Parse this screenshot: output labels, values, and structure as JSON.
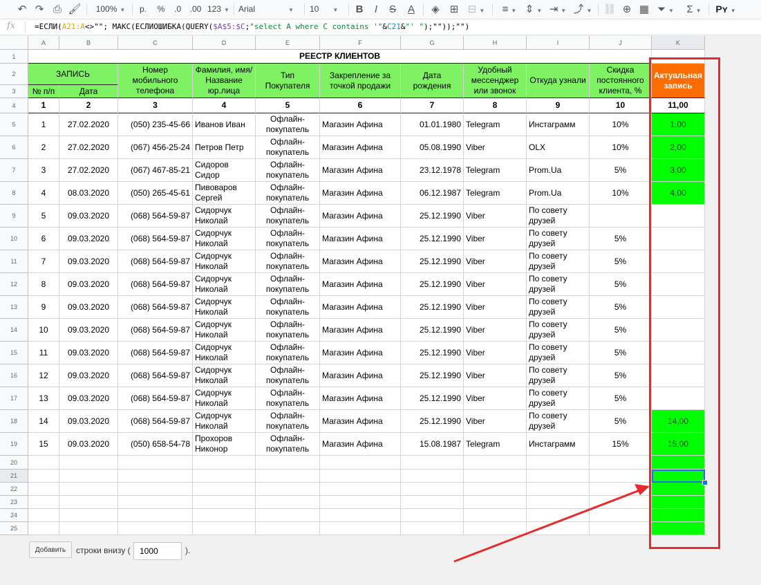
{
  "toolbar": {
    "zoom": "100%",
    "currency": "р.",
    "percent": "%",
    "dec_less": ".0",
    "dec_more": ".00",
    "num_format": "123",
    "font": "Arial",
    "size": "10",
    "sheet_script": "Pʏ",
    "icons": [
      "undo-icon",
      "redo-icon",
      "print-icon",
      "paint-format-icon",
      "bold-icon",
      "italic-icon",
      "strikethrough-icon",
      "text-color-icon",
      "fill-color-icon",
      "borders-icon",
      "merge-icon",
      "align-icon",
      "valign-icon",
      "wrap-icon",
      "rotate-icon",
      "link-icon",
      "comment-icon",
      "chart-icon",
      "filter-icon",
      "functions-icon"
    ]
  },
  "formula_bar": {
    "fx": "fx",
    "parts": {
      "p1": "=ЕСЛИ(",
      "ref1": "A21:A",
      "p2": "<>\"\"; МАКС(ЕСЛИОШИБКА(QUERY(",
      "ref2": "$A$5:$C",
      "p3": ";",
      "str1": "\"select A where C contains '\"",
      "p4": "&",
      "ref3": "C21",
      "p5": "&",
      "str2": "\"' \"",
      "p6": ");\"\"));\"\")"
    }
  },
  "columns": [
    "A",
    "B",
    "C",
    "D",
    "E",
    "F",
    "G",
    "H",
    "I",
    "J",
    "K"
  ],
  "rows": [
    "1",
    "2",
    "3",
    "4",
    "5",
    "6",
    "7",
    "8",
    "9",
    "10",
    "11",
    "12",
    "13",
    "14",
    "15",
    "16",
    "17",
    "18",
    "19",
    "20",
    "21",
    "22",
    "23",
    "24",
    "25"
  ],
  "headers": {
    "title": "РЕЕСТР КЛИЕНТОВ",
    "record": "ЗАПИСЬ",
    "num": "№ п/п",
    "date": "Дата",
    "phone": "Номер мобильного телефона",
    "name": "Фамилия, имя/ Название юр.лица",
    "buyer_type": "Тип Покупателя",
    "store": "Закрепление за точкой продажи",
    "birth": "Дата рождения",
    "messenger": "Удобный мессенджер или звонок",
    "source": "Откуда узнали",
    "discount": "Скидка постоянного клиента, %",
    "actual": "Актуальная запись"
  },
  "col_numbers": [
    "1",
    "2",
    "3",
    "4",
    "5",
    "6",
    "7",
    "8",
    "9",
    "10",
    "11,00"
  ],
  "data_rows": [
    [
      "1",
      "27.02.2020",
      "(050) 235-45-66",
      "Иванов Иван",
      "Офлайн-покупатель",
      "Магазин Афина",
      "01.01.1980",
      "Telegram",
      "Инстаграмм",
      "10%",
      "1,00"
    ],
    [
      "2",
      "27.02.2020",
      "(067) 456-25-24",
      "Петров Петр",
      "Офлайн-покупатель",
      "Магазин Афина",
      "05.08.1990",
      "Viber",
      "OLX",
      "10%",
      "2,00"
    ],
    [
      "3",
      "27.02.2020",
      "(067) 467-85-21",
      "Сидоров Сидор",
      "Офлайн-покупатель",
      "Магазин Афина",
      "23.12.1978",
      "Telegram",
      "Prom.Ua",
      "5%",
      "3,00"
    ],
    [
      "4",
      "08.03.2020",
      "(050) 265-45-61",
      "Пивоваров Сергей",
      "Офлайн-покупатель",
      "Магазин Афина",
      "06.12.1987",
      "Telegram",
      "Prom.Ua",
      "10%",
      "4,00"
    ],
    [
      "5",
      "09.03.2020",
      "(068) 564-59-87",
      "Сидорчук Николай",
      "Офлайн-покупатель",
      "Магазин Афина",
      "25.12.1990",
      "Viber",
      "По совету друзей",
      "",
      ""
    ],
    [
      "6",
      "09.03.2020",
      "(068) 564-59-87",
      "Сидорчук Николай",
      "Офлайн-покупатель",
      "Магазин Афина",
      "25.12.1990",
      "Viber",
      "По совету друзей",
      "5%",
      ""
    ],
    [
      "7",
      "09.03.2020",
      "(068) 564-59-87",
      "Сидорчук Николай",
      "Офлайн-покупатель",
      "Магазин Афина",
      "25.12.1990",
      "Viber",
      "По совету друзей",
      "5%",
      ""
    ],
    [
      "8",
      "09.03.2020",
      "(068) 564-59-87",
      "Сидорчук Николай",
      "Офлайн-покупатель",
      "Магазин Афина",
      "25.12.1990",
      "Viber",
      "По совету друзей",
      "5%",
      ""
    ],
    [
      "9",
      "09.03.2020",
      "(068) 564-59-87",
      "Сидорчук Николай",
      "Офлайн-покупатель",
      "Магазин Афина",
      "25.12.1990",
      "Viber",
      "По совету друзей",
      "5%",
      ""
    ],
    [
      "10",
      "09.03.2020",
      "(068) 564-59-87",
      "Сидорчук Николай",
      "Офлайн-покупатель",
      "Магазин Афина",
      "25.12.1990",
      "Viber",
      "По совету друзей",
      "5%",
      ""
    ],
    [
      "11",
      "09.03.2020",
      "(068) 564-59-87",
      "Сидорчук Николай",
      "Офлайн-покупатель",
      "Магазин Афина",
      "25.12.1990",
      "Viber",
      "По совету друзей",
      "5%",
      ""
    ],
    [
      "12",
      "09.03.2020",
      "(068) 564-59-87",
      "Сидорчук Николай",
      "Офлайн-покупатель",
      "Магазин Афина",
      "25.12.1990",
      "Viber",
      "По совету друзей",
      "5%",
      ""
    ],
    [
      "13",
      "09.03.2020",
      "(068) 564-59-87",
      "Сидорчук Николай",
      "Офлайн-покупатель",
      "Магазин Афина",
      "25.12.1990",
      "Viber",
      "По совету друзей",
      "5%",
      ""
    ],
    [
      "14",
      "09.03.2020",
      "(068) 564-59-87",
      "Сидорчук Николай",
      "Офлайн-покупатель",
      "Магазин Афина",
      "25.12.1990",
      "Viber",
      "По совету друзей",
      "5%",
      "14,00"
    ],
    [
      "15",
      "09.03.2020",
      "(050) 658-54-78",
      "Прохоров Никонор",
      "Офлайн-покупатель",
      "Магазин Афина",
      "15.08.1987",
      "Telegram",
      "Инстаграмм",
      "15%",
      "15,00"
    ]
  ],
  "highlighted_k": [
    true,
    true,
    true,
    true,
    false,
    false,
    false,
    false,
    false,
    false,
    false,
    false,
    false,
    true,
    true
  ],
  "bottom": {
    "add_button": "Добавить",
    "rows_label": "строки внизу (",
    "rows_value": "1000",
    "rows_suffix": ")."
  },
  "colors": {
    "header_green": "#7ef262",
    "bright_green": "#00ff00",
    "orange": "#ff6d01",
    "annotation_red": "#e82a2a",
    "selection_blue": "#1a73e8"
  }
}
